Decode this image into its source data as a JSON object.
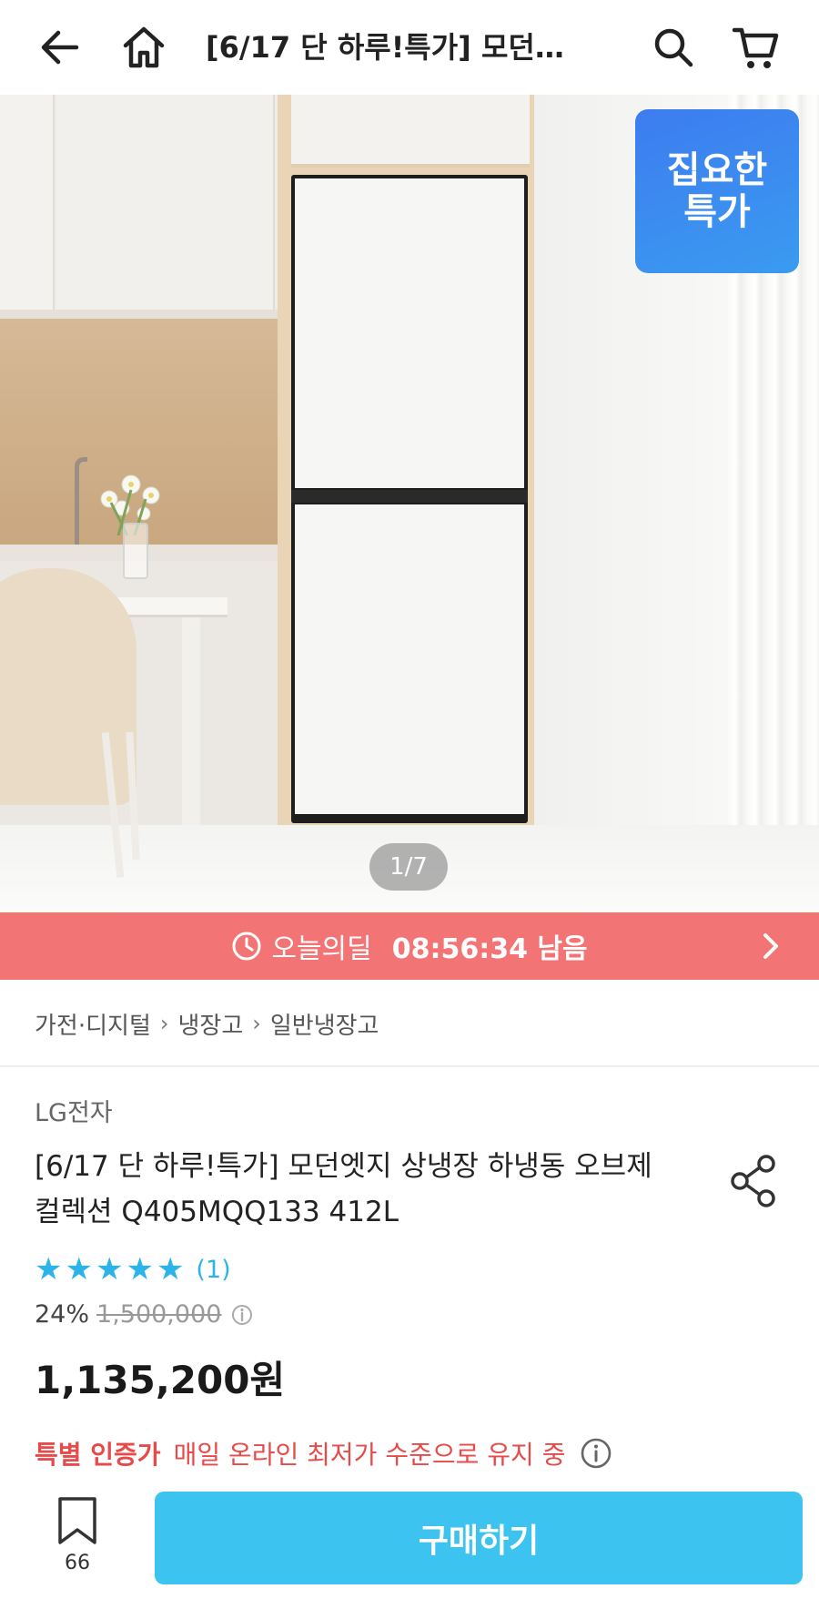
{
  "header": {
    "title": "[6/17 단 하루!특가] 모던…"
  },
  "hero": {
    "badge_line1": "집요한",
    "badge_line2": "특가",
    "page_indicator": "1/7"
  },
  "deal_bar": {
    "label": "오늘의딜",
    "time": "08:56:34 남음"
  },
  "breadcrumb": {
    "items": [
      "가전·디지털",
      "냉장고",
      "일반냉장고"
    ]
  },
  "product": {
    "brand": "LG전자",
    "title": "[6/17 단 하루!특가] 모던엣지 상냉장 하냉동 오브제컬렉션 Q405MQQ133 412L",
    "rating_stars": 5,
    "review_count": "(1)",
    "discount": "24%",
    "original_price": "1,500,000",
    "sale_price": "1,135,200원",
    "special_label": "특별 인증가",
    "special_text": "매일 온라인 최저가 수준으로 유지 중"
  },
  "bottom_bar": {
    "bookmark_count": "66",
    "buy_label": "구매하기"
  },
  "colors": {
    "accent": "#3cc3ef",
    "deal_bar": "#f27474",
    "star": "#2cb4e8",
    "special": "#e84a4a",
    "badge": "#3d7cf0"
  }
}
